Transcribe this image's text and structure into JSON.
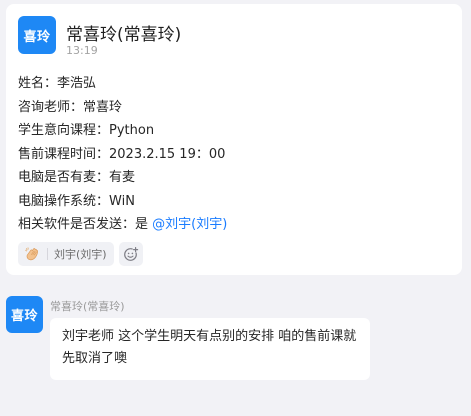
{
  "card": {
    "avatar_text": "喜玲",
    "title": "常喜玲(常喜玲)",
    "time": "13:19",
    "fields": [
      {
        "label": "姓名：",
        "value": "李浩弘"
      },
      {
        "label": "咨询老师：",
        "value": "常喜玲"
      },
      {
        "label": "学生意向课程：",
        "value": "Python"
      },
      {
        "label": "售前课程时间：",
        "value": "2023.2.15 19：00"
      },
      {
        "label": "电脑是否有麦：",
        "value": "有麦"
      },
      {
        "label": "电脑操作系统：",
        "value": "WiN"
      }
    ],
    "send_field": {
      "label": "相关软件是否发送：",
      "value": "是 ",
      "mention": "@刘宇(刘宇)"
    },
    "reaction": {
      "icon": "clap-hand-icon",
      "user": "刘宇(刘宇)"
    },
    "add_reaction_icon": "add-emoji-icon"
  },
  "message": {
    "avatar_text": "喜玲",
    "sender": "常喜玲(常喜玲)",
    "text": "刘宇老师 这个学生明天有点别的安排 咱的售前课就先取消了噢"
  },
  "colors": {
    "accent": "#1e88f5",
    "mention": "#1a7cff",
    "background": "#f2f2f6"
  }
}
